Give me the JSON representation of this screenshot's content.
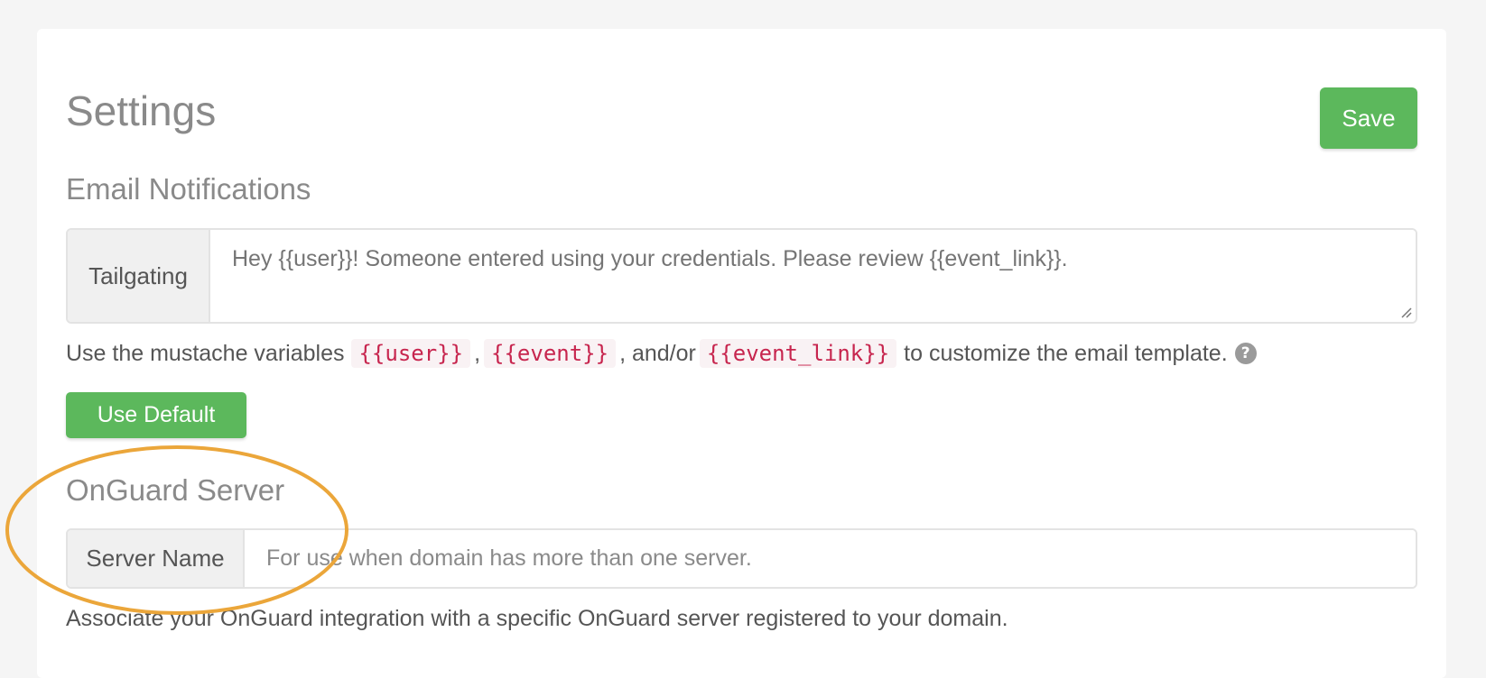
{
  "header": {
    "title": "Settings",
    "save_label": "Save"
  },
  "email_notifications": {
    "title": "Email Notifications",
    "tailgating_label": "Tailgating",
    "tailgating_placeholder": "Hey {{user}}! Someone entered using your credentials. Please review {{event_link}}.",
    "help_prefix": "Use the mustache variables",
    "var_user": "{{user}}",
    "sep1": ",",
    "var_event": "{{event}}",
    "sep2": ", and/or",
    "var_event_link": "{{event_link}}",
    "help_suffix": "to customize the email template.",
    "help_icon": "?",
    "use_default_label": "Use Default"
  },
  "onguard_server": {
    "title": "OnGuard Server",
    "server_name_label": "Server Name",
    "server_name_placeholder": "For use when domain has more than one server.",
    "help_text": "Associate your OnGuard integration with a specific OnGuard server registered to your domain."
  },
  "colors": {
    "accent_green": "#5cb85c",
    "highlight_orange": "#eba63a",
    "code_red": "#c7254e"
  }
}
